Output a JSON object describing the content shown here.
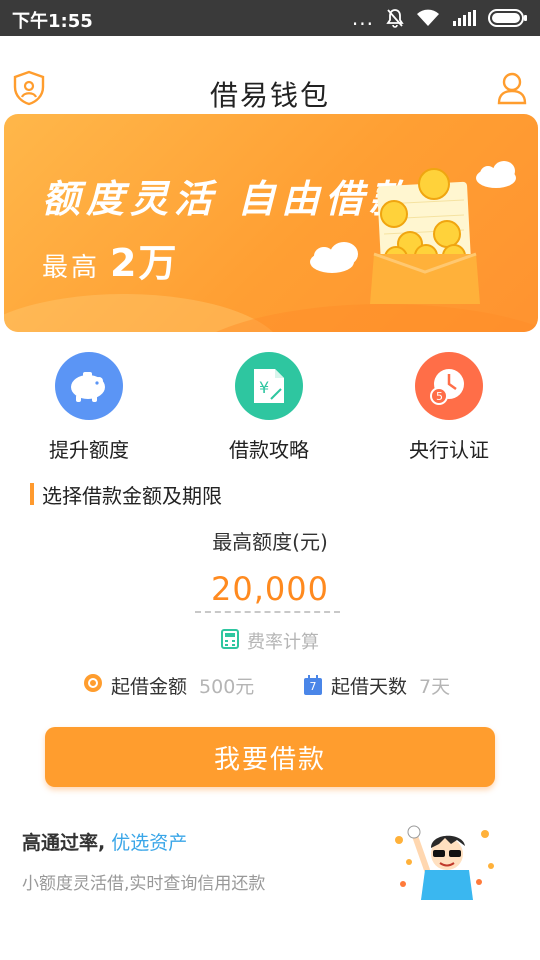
{
  "status_bar": {
    "time": "下午1:55",
    "dots": "..."
  },
  "header": {
    "title": "借易钱包"
  },
  "banner": {
    "headline": "额度灵活 自由借款",
    "sub_label": "最高",
    "sub_value": "2万"
  },
  "features": [
    {
      "label": "提升额度",
      "color": "#5b95f5",
      "icon": "piggy-bank-icon"
    },
    {
      "label": "借款攻略",
      "color": "#2ec6a0",
      "icon": "money-document-icon"
    },
    {
      "label": "央行认证",
      "color": "#ff6e48",
      "icon": "clock-badge-icon"
    }
  ],
  "section": {
    "title": "选择借款金额及期限"
  },
  "amount": {
    "label": "最高额度(元)",
    "value": "20,000",
    "rate_label": "费率计算"
  },
  "limits": {
    "min_amount_label": "起借金额",
    "min_amount_value": "500元",
    "min_days_label": "起借天数",
    "min_days_value": "7天",
    "calendar_day": "7"
  },
  "cta": {
    "label": "我要借款"
  },
  "promo": {
    "title": "高通过率,",
    "highlight": "优选资产",
    "subtitle": "小额度灵活借,实时查询信用还款"
  },
  "colors": {
    "accent": "#ff9d2e",
    "amount": "#ff8a1f",
    "highlight": "#3aa6e8",
    "statusbar": "#3a3a3a"
  }
}
